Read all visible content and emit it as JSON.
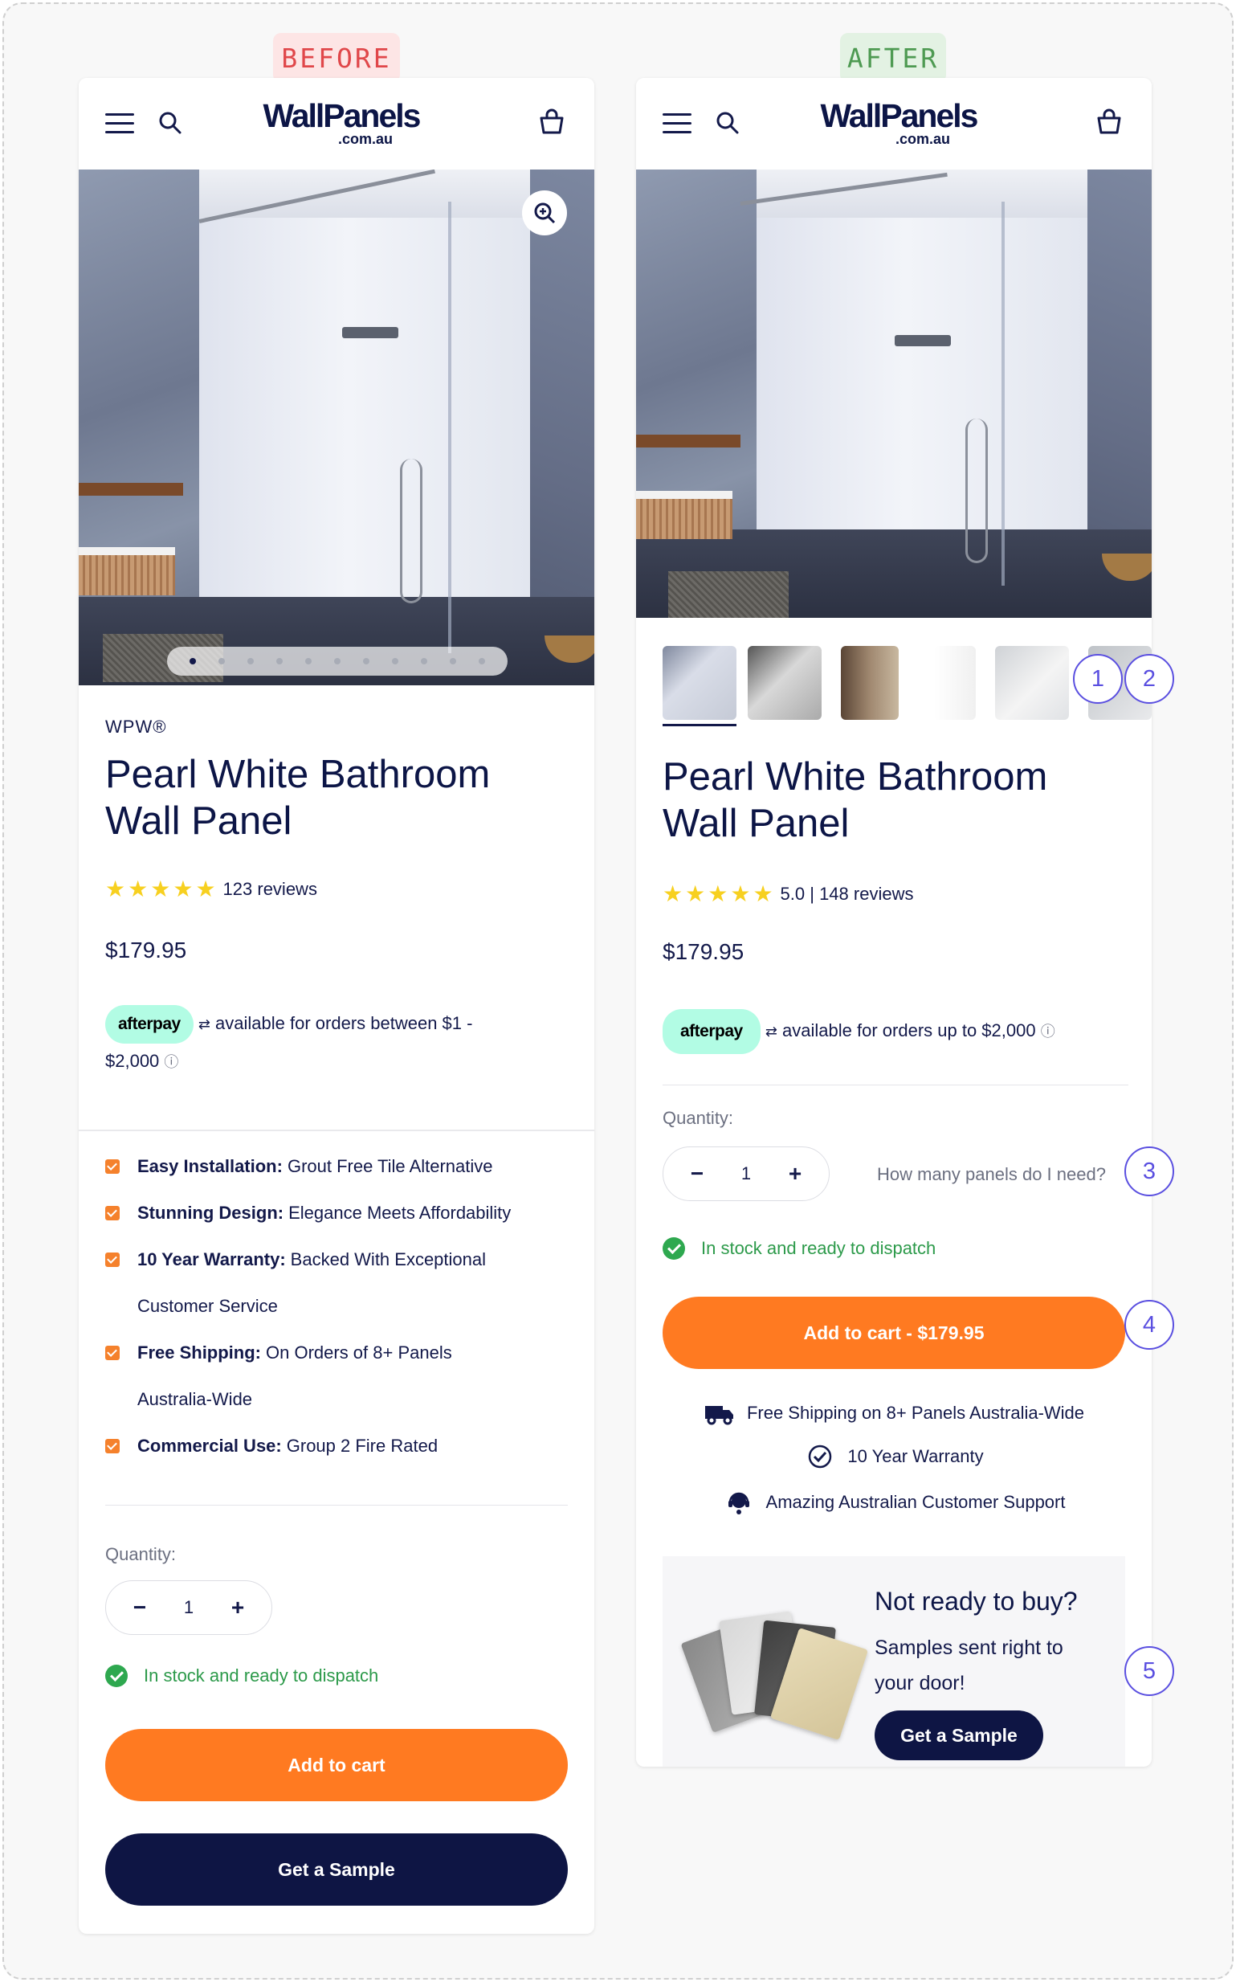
{
  "labels": {
    "before": "BEFORE",
    "after": "AFTER"
  },
  "header": {
    "logo_main": "WallPanels",
    "logo_sub": ".com.au",
    "icons": [
      "menu-icon",
      "search-icon",
      "cart-icon"
    ]
  },
  "colors": {
    "accent": "#ff7a21",
    "navy": "#0e1544",
    "stock_green": "#2c9a4a",
    "afterpay": "#b2fce4",
    "marker": "#5a4fe0"
  },
  "before": {
    "vendor": "WPW®",
    "title": "Pearl White Bathroom Wall Panel",
    "reviews": "123 reviews",
    "price": "$179.95",
    "afterpay_label": "afterpay",
    "afterpay_text": "available for orders between $1 -",
    "afterpay_text_2": "$2,000",
    "features": [
      {
        "bold": "Easy Installation:",
        "text": "Grout Free Tile Alternative"
      },
      {
        "bold": "Stunning Design:",
        "text": "Elegance Meets Affordability"
      },
      {
        "bold": "10 Year Warranty:",
        "text": "Backed With Exceptional",
        "cont": "Customer Service"
      },
      {
        "bold": "Free Shipping:",
        "text": "On Orders of 8+ Panels",
        "cont": "Australia-Wide"
      },
      {
        "bold": "Commercial Use:",
        "text": "Group 2 Fire Rated"
      }
    ],
    "quantity_label": "Quantity:",
    "quantity_value": "1",
    "stock": "In stock and ready to dispatch",
    "add_to_cart": "Add to cart",
    "get_sample": "Get a Sample",
    "slide_count": 11,
    "active_slide": 1
  },
  "after": {
    "title": "Pearl White Bathroom Wall Panel",
    "rating": "5.0 | 148 reviews",
    "price": "$179.95",
    "afterpay_label": "afterpay",
    "afterpay_text": "available for orders up to $2,000",
    "quantity_label": "Quantity:",
    "quantity_value": "1",
    "how_many": "How many panels do I need?",
    "stock": "In stock and ready to dispatch",
    "add_to_cart": "Add to cart - $179.95",
    "usps": [
      {
        "icon": "truck-icon",
        "text": "Free Shipping on 8+ Panels Australia-Wide"
      },
      {
        "icon": "check-badge-icon",
        "text": "10 Year Warranty"
      },
      {
        "icon": "support-agent-icon",
        "text": "Amazing Australian Customer Support"
      }
    ],
    "sample_title": "Not ready to buy?",
    "sample_sub": "Samples sent right to your door!",
    "sample_button": "Get a Sample"
  },
  "markers": [
    "1",
    "2",
    "3",
    "4",
    "5"
  ]
}
